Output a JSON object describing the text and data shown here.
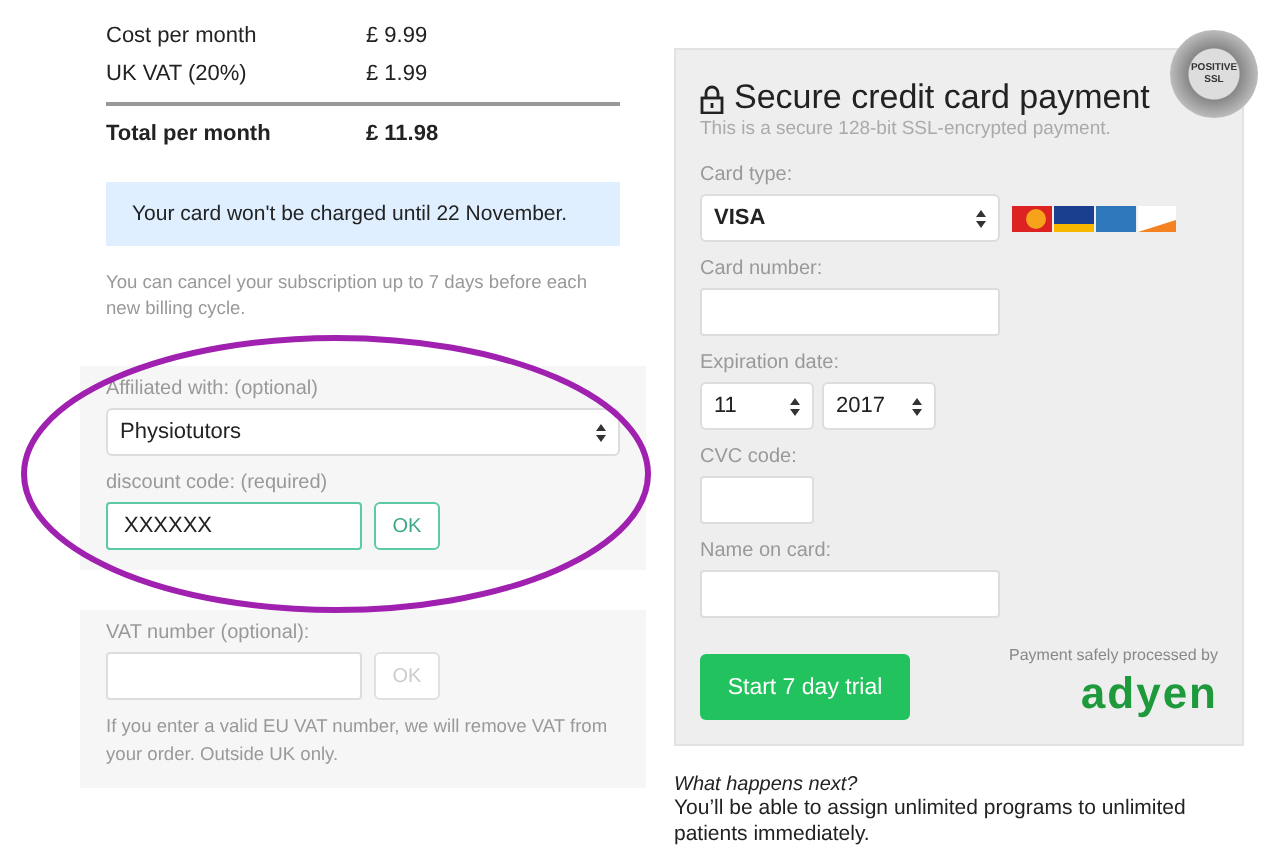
{
  "summary": {
    "rows": [
      {
        "label": "Cost per month",
        "amount": "£ 9.99",
        "kind": "line"
      },
      {
        "label": "UK VAT (20%)",
        "amount": "£ 1.99",
        "kind": "line"
      },
      {
        "label": "Total per month",
        "amount": "£ 11.98",
        "kind": "total"
      }
    ]
  },
  "notice": "Your card won't be charged until 22 November.",
  "cancel_note": "You can cancel your subscription up to 7 days before each new billing cycle.",
  "affiliation": {
    "label": "Affiliated with: (optional)",
    "value": "Physiotutors",
    "code_label": "discount code: (required)",
    "code_value": "XXXXXX",
    "code_focused": true,
    "button": {
      "label": "OK",
      "disabled": false
    }
  },
  "vat": {
    "label": "VAT number (optional):",
    "button": {
      "label": "OK",
      "disabled": true
    },
    "note": "If you enter a valid EU VAT number, we will remove VAT from your order. Outside UK only."
  },
  "payment": {
    "title": "Secure credit card payment",
    "subtitle": "This is a secure 128-bit SSL-encrypted payment.",
    "seal": [
      "POSITIVE",
      "SSL"
    ],
    "card_type": {
      "label": "Card type:",
      "value": "VISA"
    },
    "card_number": {
      "label": "Card number:"
    },
    "expiration": {
      "label": "Expiration date:",
      "month": "11",
      "year": "2017"
    },
    "cvc": {
      "label": "CVC code:"
    },
    "name": {
      "label": "Name on card:"
    },
    "submit": "Start 7 day trial",
    "processor_note": "Payment safely processed by",
    "processor": "adyen"
  },
  "next": {
    "title": "What happens next?",
    "text": "You’ll be able to assign unlimited programs to unlimited patients immediately."
  },
  "annotation": {
    "kind": "ellipse",
    "color": "#a020b0"
  }
}
